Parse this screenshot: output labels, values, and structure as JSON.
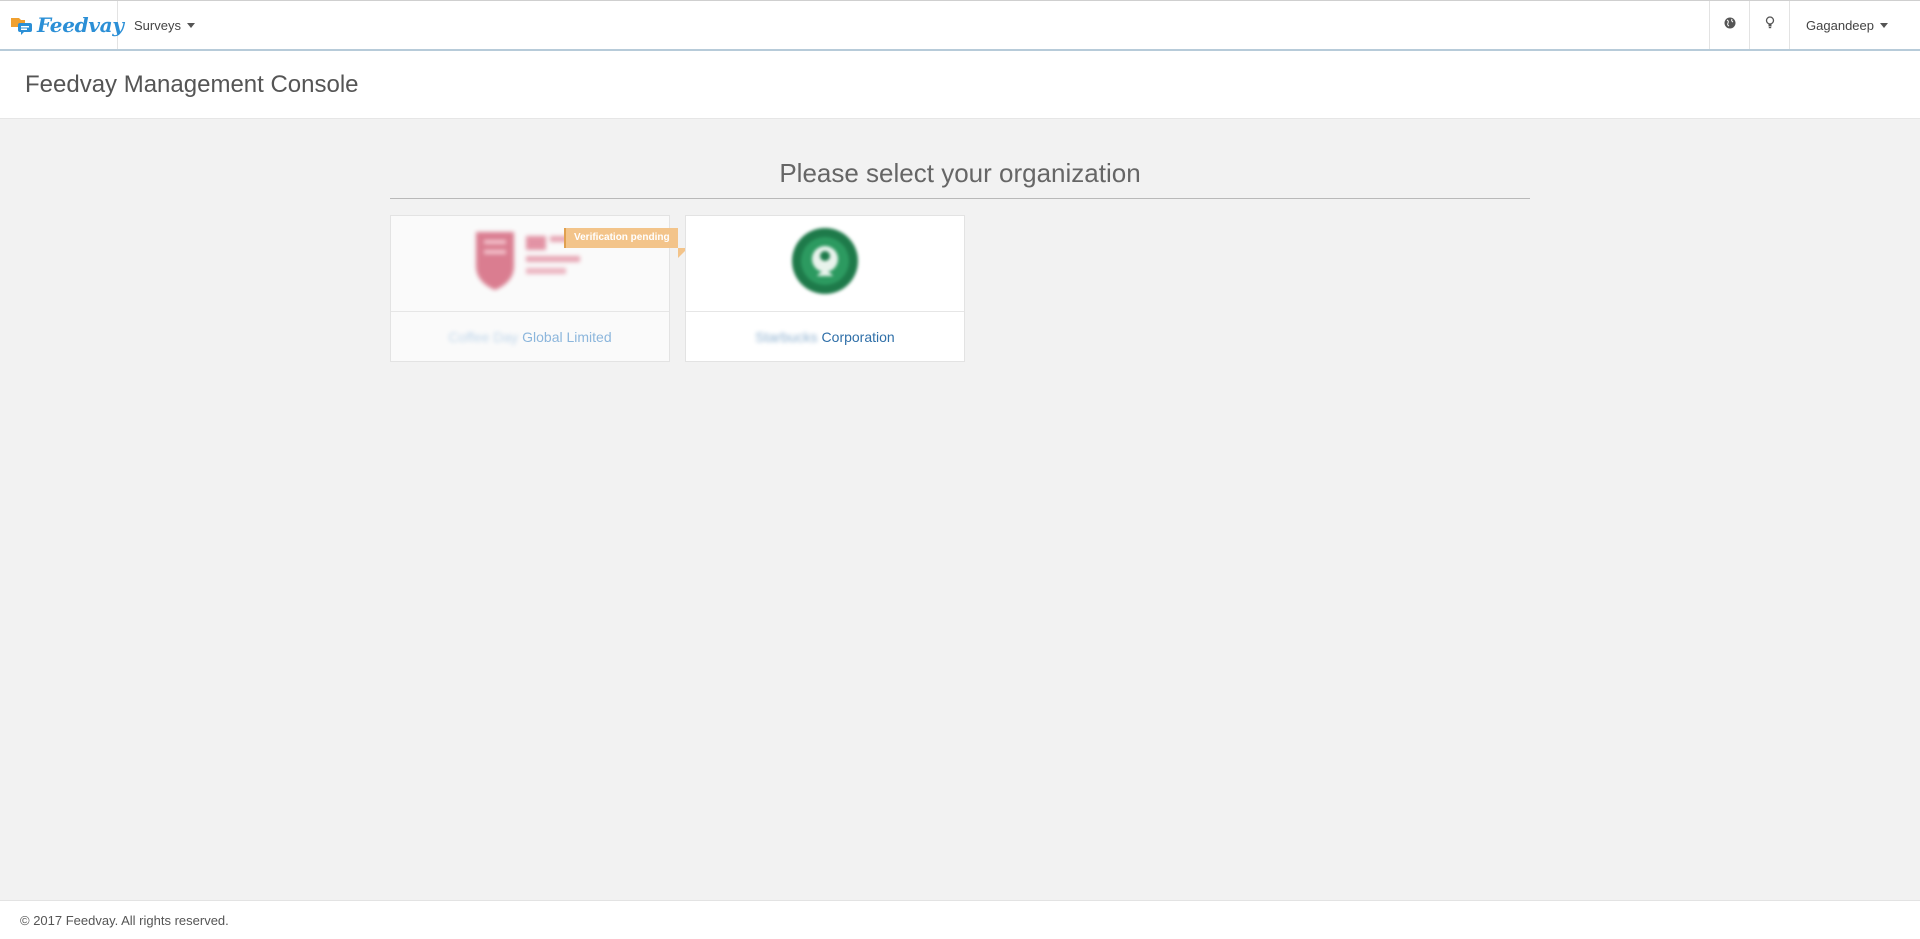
{
  "navbar": {
    "brand": "Feedvay",
    "surveys_label": "Surveys",
    "globe_icon": "globe-icon",
    "bulb_icon": "lightbulb-icon",
    "user_name": "Gagandeep"
  },
  "header": {
    "title": "Feedvay Management Console"
  },
  "main": {
    "heading": "Please select your organization",
    "organizations": [
      {
        "name_blurred": "Coffee Day",
        "name_visible": "Global Limited",
        "badge": "Verification pending"
      },
      {
        "name_blurred": "Starbucks",
        "name_visible": "Corporation"
      }
    ]
  },
  "footer": {
    "text": "© 2017 Feedvay. All rights reserved."
  },
  "colors": {
    "brand_blue": "#2b8fd6",
    "link_blue": "#2f6fa8",
    "badge_orange": "#f3c48a",
    "background": "#f2f2f2"
  }
}
